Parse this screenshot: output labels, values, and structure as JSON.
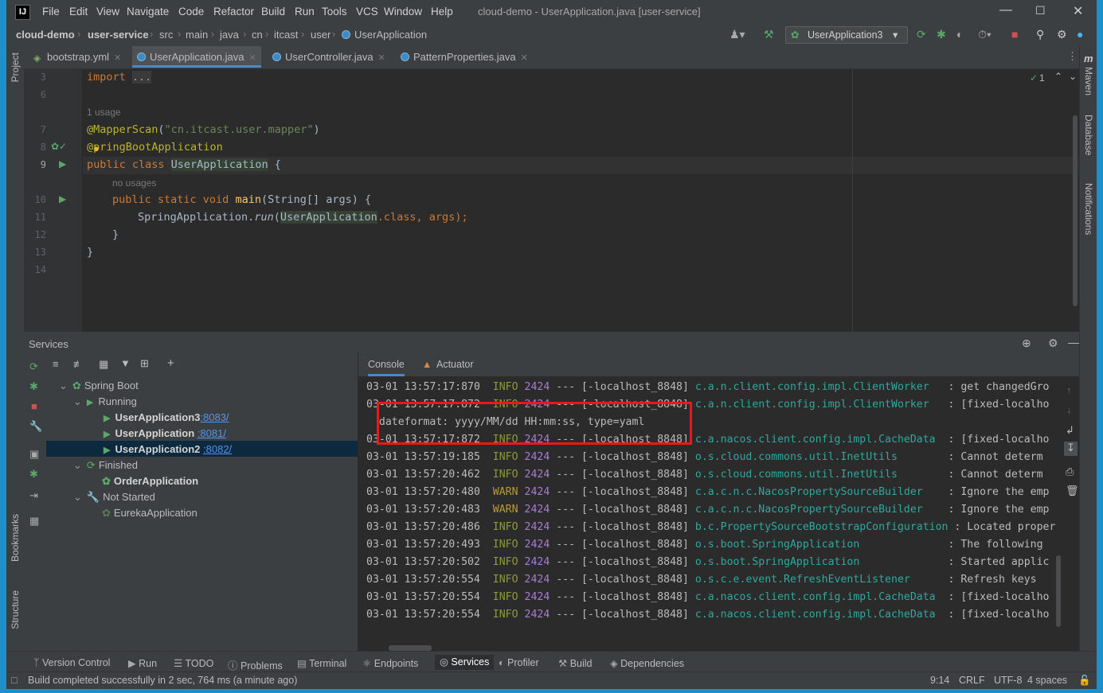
{
  "menu": [
    "File",
    "Edit",
    "View",
    "Navigate",
    "Code",
    "Refactor",
    "Build",
    "Run",
    "Tools",
    "VCS",
    "Window",
    "Help"
  ],
  "window_title": "cloud-demo - UserApplication.java [user-service]",
  "breadcrumb": [
    "cloud-demo",
    "user-service",
    "src",
    "main",
    "java",
    "cn",
    "itcast",
    "user",
    "UserApplication"
  ],
  "run_config": "UserApplication3",
  "tabs": [
    {
      "label": "bootstrap.yml"
    },
    {
      "label": "UserApplication.java"
    },
    {
      "label": "UserController.java"
    },
    {
      "label": "PatternProperties.java"
    }
  ],
  "left_strip": {
    "project": "Project",
    "bookmarks": "Bookmarks",
    "structure": "Structure"
  },
  "right_strip": {
    "maven": "Maven",
    "database": "Database",
    "notifications": "Notifications"
  },
  "inspection_count": "1",
  "editor": {
    "line_numbers": [
      "3",
      "6",
      "7",
      "8",
      "9",
      "10",
      "11",
      "12",
      "13",
      "14"
    ],
    "hint_usage": "1 usage",
    "hint_no_usages": "no usages",
    "import_kw": "import",
    "import_fold": "...",
    "ann_mapper": "@MapperScan",
    "mapper_arg": "\"cn.itcast.user.mapper\"",
    "paren_open": "(",
    "paren_close": ")",
    "ann_sb_at": "@",
    "ann_sb_rest": "pringBootApplication",
    "kw_public_class": "public class ",
    "class_name": "UserApplication",
    "brace_open": " {",
    "kw_main": "public static void ",
    "main_name": "main",
    "main_params": "(String[] args) {",
    "run_prefix": "SpringApplication.",
    "run_method": "run",
    "run_paren": "(",
    "run_cls": "UserApplication",
    "run_class_kw": ".class",
    "run_rest": ", args);",
    "close_inner": "}",
    "close_outer": "}"
  },
  "services": {
    "title": "Services",
    "tree": {
      "spring_boot": "Spring Boot",
      "running": "Running",
      "app3": "UserApplication3",
      "app3_port": ":8083/",
      "app1": "UserApplication",
      "app1_port": ":8081/",
      "app2": "UserApplication2",
      "app2_port": ":8082/",
      "finished": "Finished",
      "order": "OrderApplication",
      "not_started": "Not Started",
      "eureka": "EurekaApplication"
    }
  },
  "console": {
    "tab_console": "Console",
    "tab_actuator": "Actuator",
    "lines": [
      {
        "time": "03-01 13:57:17:870",
        "level": "INFO",
        "pid": "2424",
        "thread": "--- [-localhost_8848]",
        "logger": "c.a.n.client.config.impl.ClientWorker",
        "msg": "   : get changedGro"
      },
      {
        "time": "03-01 13:57:17:872",
        "level": "INFO",
        "pid": "2424",
        "thread": "--- [-localhost_8848]",
        "logger": "c.a.n.client.config.impl.ClientWorker",
        "msg": "   : [fixed-localho"
      },
      {
        "raw": "  dateformat: yyyy/MM/dd HH:mm:ss, type=yaml"
      },
      {
        "time": "03-01 13:57:17:872",
        "level": "INFO",
        "pid": "2424",
        "thread": "--- [-localhost_8848]",
        "logger": "c.a.nacos.client.config.impl.CacheData",
        "msg": "  : [fixed-localho"
      },
      {
        "time": "03-01 13:57:19:185",
        "level": "INFO",
        "pid": "2424",
        "thread": "--- [-localhost_8848]",
        "logger": "o.s.cloud.commons.util.InetUtils",
        "msg": "        : Cannot determ"
      },
      {
        "time": "03-01 13:57:20:462",
        "level": "INFO",
        "pid": "2424",
        "thread": "--- [-localhost_8848]",
        "logger": "o.s.cloud.commons.util.InetUtils",
        "msg": "        : Cannot determ"
      },
      {
        "time": "03-01 13:57:20:480",
        "level": "WARN",
        "pid": "2424",
        "thread": "--- [-localhost_8848]",
        "logger": "c.a.c.n.c.NacosPropertySourceBuilder",
        "msg": "    : Ignore the emp"
      },
      {
        "time": "03-01 13:57:20:483",
        "level": "WARN",
        "pid": "2424",
        "thread": "--- [-localhost_8848]",
        "logger": "c.a.c.n.c.NacosPropertySourceBuilder",
        "msg": "    : Ignore the emp"
      },
      {
        "time": "03-01 13:57:20:486",
        "level": "INFO",
        "pid": "2424",
        "thread": "--- [-localhost_8848]",
        "logger": "b.c.PropertySourceBootstrapConfiguration",
        "msg": " : Located proper"
      },
      {
        "time": "03-01 13:57:20:493",
        "level": "INFO",
        "pid": "2424",
        "thread": "--- [-localhost_8848]",
        "logger": "o.s.boot.SpringApplication",
        "msg": "              : The following"
      },
      {
        "time": "03-01 13:57:20:502",
        "level": "INFO",
        "pid": "2424",
        "thread": "--- [-localhost_8848]",
        "logger": "o.s.boot.SpringApplication",
        "msg": "              : Started applic"
      },
      {
        "time": "03-01 13:57:20:554",
        "level": "INFO",
        "pid": "2424",
        "thread": "--- [-localhost_8848]",
        "logger": "o.s.c.e.event.RefreshEventListener",
        "msg": "      : Refresh keys"
      },
      {
        "time": "03-01 13:57:20:554",
        "level": "INFO",
        "pid": "2424",
        "thread": "--- [-localhost_8848]",
        "logger": "c.a.nacos.client.config.impl.CacheData",
        "msg": "  : [fixed-localho"
      },
      {
        "time": "03-01 13:57:20:554",
        "level": "INFO",
        "pid": "2424",
        "thread": "--- [-localhost_8848]",
        "logger": "c.a.nacos.client.config.impl.CacheData",
        "msg": "  : [fixed-localho"
      }
    ]
  },
  "bottom_tabs": [
    "Version Control",
    "Run",
    "TODO",
    "Problems",
    "Terminal",
    "Endpoints",
    "Services",
    "Profiler",
    "Build",
    "Dependencies"
  ],
  "status": {
    "message": "Build completed successfully in 2 sec, 764 ms (a minute ago)",
    "position": "9:14",
    "line_sep": "CRLF",
    "encoding": "UTF-8",
    "indent": "4 spaces"
  }
}
